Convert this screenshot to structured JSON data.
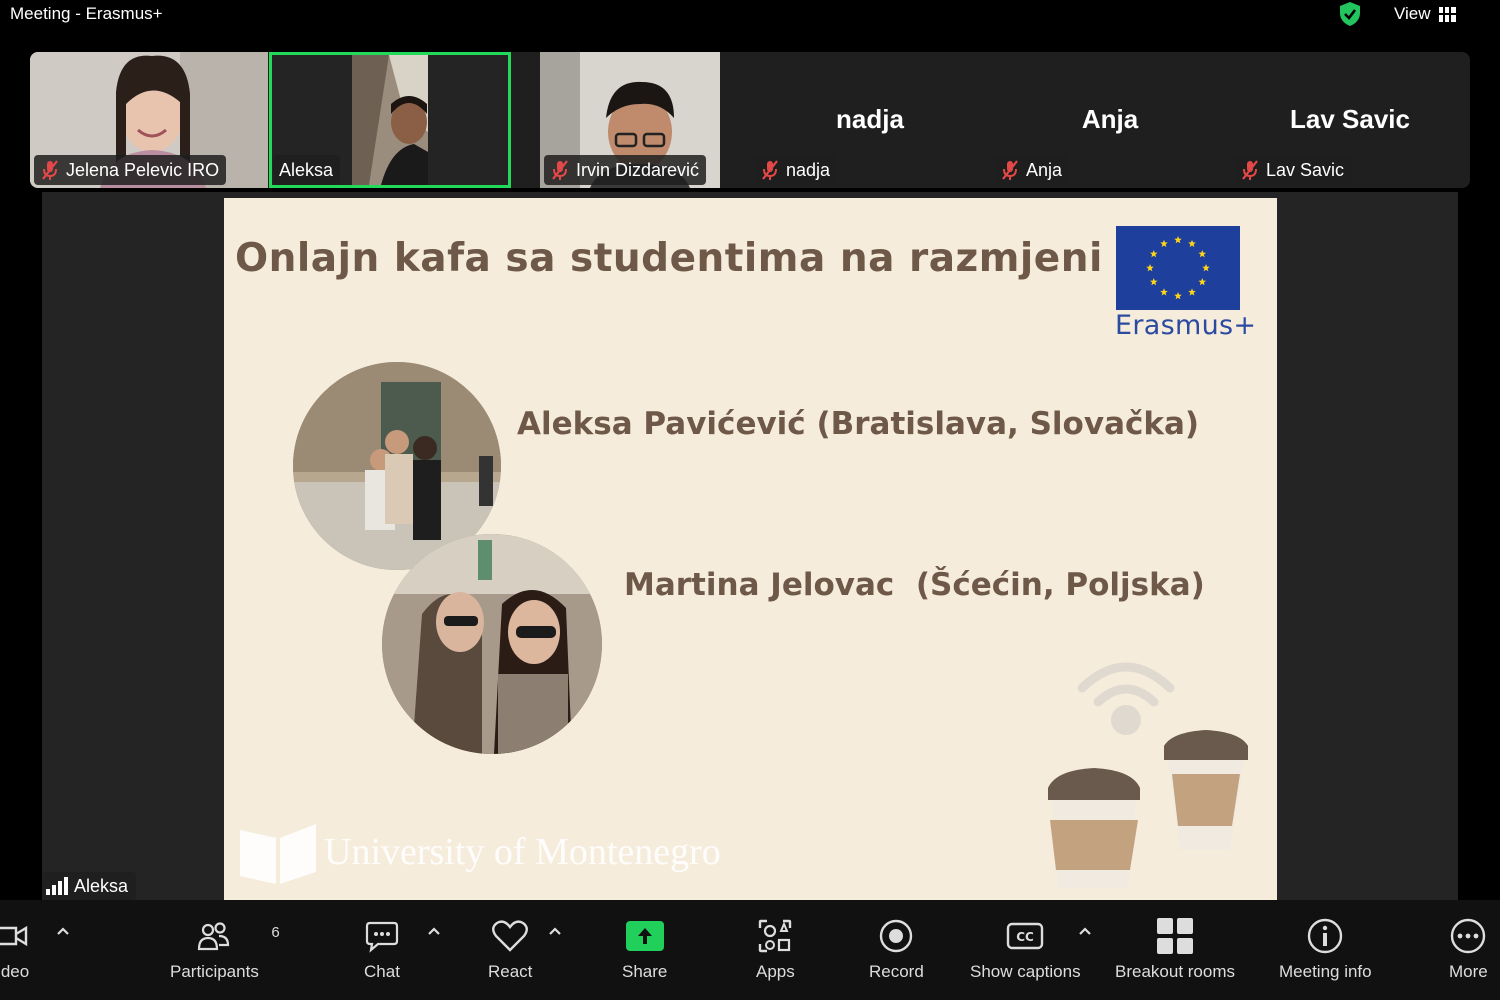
{
  "window": {
    "title": "Meeting - Erasmus+",
    "view_label": "View"
  },
  "colors": {
    "active_speaker_border": "#23d959",
    "shield": "#22c55e",
    "share_button": "#21d05a",
    "slide_bg": "#f5ecdc",
    "slide_text": "#6e5848",
    "eu_blue": "#1f3f9c"
  },
  "participants": [
    {
      "name": "Jelena Pelevic IRO",
      "muted": true,
      "video": true
    },
    {
      "name": "Aleksa",
      "muted": false,
      "video": true,
      "active": true
    },
    {
      "name": "Irvin Dizdarević",
      "muted": true,
      "video": true
    },
    {
      "name": "nadja",
      "muted": true,
      "video": false,
      "display_name": "nadja"
    },
    {
      "name": "Anja",
      "muted": true,
      "video": false,
      "display_name": "Anja"
    },
    {
      "name": "Lav Savic",
      "muted": true,
      "video": false,
      "display_name": "Lav Savic"
    }
  ],
  "slide": {
    "title": "Onlajn kafa sa studentima na razmjeni",
    "logo_text": "Erasmus+",
    "students": [
      "Aleksa Pavićević (Bratislava, Slovačka)",
      "Martina Jelovac  (Šćećin, Poljska)"
    ],
    "university": "University of Montenegro"
  },
  "active_speaker": "Aleksa",
  "toolbar": {
    "video_label": "deo",
    "participants_label": "Participants",
    "participants_count": "6",
    "chat_label": "Chat",
    "react_label": "React",
    "share_label": "Share",
    "apps_label": "Apps",
    "record_label": "Record",
    "captions_label": "Show captions",
    "breakout_label": "Breakout rooms",
    "info_label": "Meeting info",
    "more_label": "More"
  }
}
